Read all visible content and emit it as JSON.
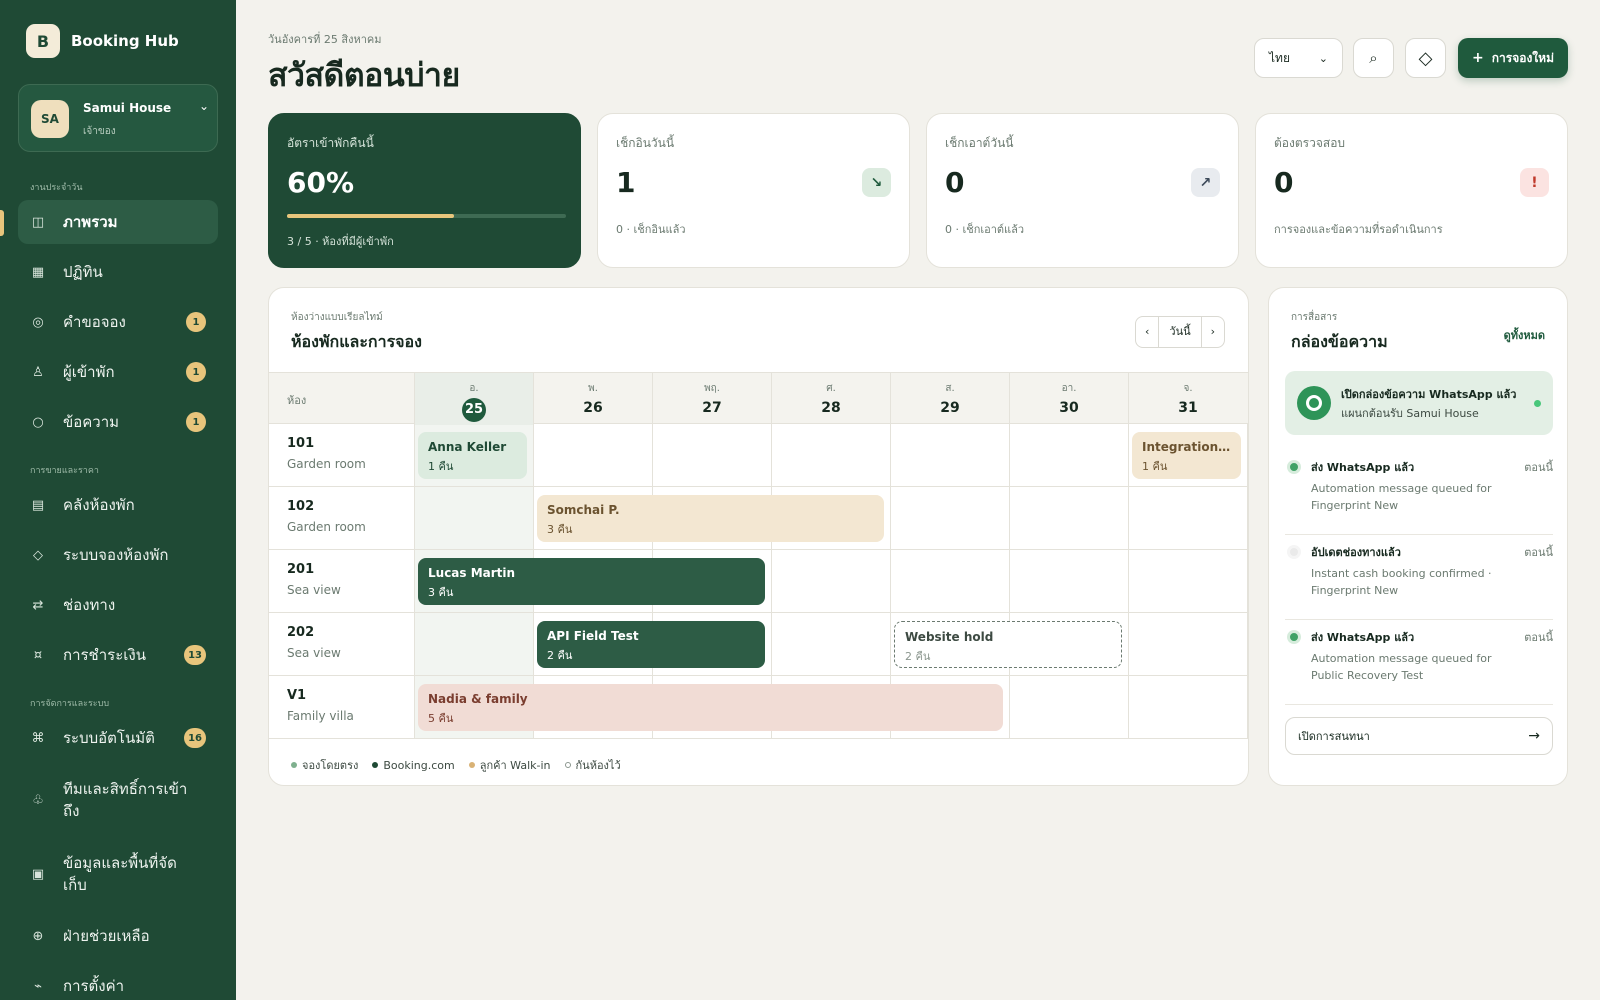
{
  "app": {
    "logo_letter": "B",
    "name": "Booking Hub"
  },
  "property": {
    "initials": "SA",
    "name": "Samui House",
    "role": "เจ้าของ"
  },
  "sidebar": {
    "sections": {
      "daily": "งานประจำวัน",
      "sales": "การขายและราคา",
      "admin": "การจัดการและระบบ"
    },
    "items": [
      {
        "label": "ภาพรวม",
        "icon": "◫",
        "badge": ""
      },
      {
        "label": "ปฏิทิน",
        "icon": "▦",
        "badge": ""
      },
      {
        "label": "คำขอจอง",
        "icon": "◎",
        "badge": "1"
      },
      {
        "label": "ผู้เข้าพัก",
        "icon": "♙",
        "badge": "1"
      },
      {
        "label": "ข้อความ",
        "icon": "○",
        "badge": "1"
      },
      {
        "label": "คลังห้องพัก",
        "icon": "▤",
        "badge": ""
      },
      {
        "label": "ระบบจองห้องพัก",
        "icon": "◇",
        "badge": ""
      },
      {
        "label": "ช่องทาง",
        "icon": "⇄",
        "badge": ""
      },
      {
        "label": "การชำระเงิน",
        "icon": "¤",
        "badge": "13"
      },
      {
        "label": "ระบบอัตโนมัติ",
        "icon": "⌘",
        "badge": "16"
      },
      {
        "label": "ทีมและสิทธิ์การเข้าถึง",
        "icon": "♧",
        "badge": ""
      },
      {
        "label": "ข้อมูลและพื้นที่จัดเก็บ",
        "icon": "▣",
        "badge": ""
      },
      {
        "label": "ฝ่ายช่วยเหลือ",
        "icon": "⊕",
        "badge": ""
      },
      {
        "label": "การตั้งค่า",
        "icon": "⌁",
        "badge": ""
      }
    ]
  },
  "header": {
    "date": "วันอังคารที่ 25 สิงหาคม",
    "greeting": "สวัสดีตอนบ่าย",
    "language": "ไทย",
    "search_icon": "⌕",
    "theme_icon": "◇",
    "new_booking": "การจองใหม่",
    "new_booking_icon": "+"
  },
  "stats": [
    {
      "label": "อัตราเข้าพักคืนนี้",
      "value": "60%",
      "sub": "3 / 5 · ห้องที่มีผู้เข้าพัก",
      "progress": 0.6
    },
    {
      "label": "เช็กอินวันนี้",
      "value": "1",
      "sub": "0 · เช็กอินแล้ว",
      "icon": "↘"
    },
    {
      "label": "เช็กเอาต์วันนี้",
      "value": "0",
      "sub": "0 · เช็กเอาต์แล้ว",
      "icon": "↗"
    },
    {
      "label": "ต้องตรวจสอบ",
      "value": "0",
      "sub": "การจองและข้อความที่รอดำเนินการ",
      "icon": "!"
    }
  ],
  "calendar": {
    "overline": "ห้องว่างแบบเรียลไทม์",
    "title": "ห้องพักและการจอง",
    "prev": "‹",
    "today": "วันนี้",
    "next": "›",
    "room_header": "ห้อง",
    "days": [
      {
        "dow": "อ.",
        "num": "25"
      },
      {
        "dow": "พ.",
        "num": "26"
      },
      {
        "dow": "พฤ.",
        "num": "27"
      },
      {
        "dow": "ศ.",
        "num": "28"
      },
      {
        "dow": "ส.",
        "num": "29"
      },
      {
        "dow": "อา.",
        "num": "30"
      },
      {
        "dow": "จ.",
        "num": "31"
      }
    ],
    "rooms": [
      {
        "num": "101",
        "type": "Garden room"
      },
      {
        "num": "102",
        "type": "Garden room"
      },
      {
        "num": "201",
        "type": "Sea view"
      },
      {
        "num": "202",
        "type": "Sea view"
      },
      {
        "num": "V1",
        "type": "Family villa"
      }
    ],
    "bookings": [
      {
        "name": "Anna Keller",
        "nights": "1 คืน",
        "room": 0,
        "start": 0,
        "len": 1,
        "kind": "direct"
      },
      {
        "name": "Integration Test",
        "nights": "1 คืน",
        "room": 0,
        "start": 6,
        "len": 1,
        "kind": "walkin"
      },
      {
        "name": "Somchai P.",
        "nights": "3 คืน",
        "room": 1,
        "start": 1,
        "len": 3,
        "kind": "walkin"
      },
      {
        "name": "Lucas Martin",
        "nights": "3 คืน",
        "room": 2,
        "start": 0,
        "len": 3,
        "kind": "booking"
      },
      {
        "name": "API Field Test",
        "nights": "2 คืน",
        "room": 3,
        "start": 1,
        "len": 2,
        "kind": "booking"
      },
      {
        "name": "Website hold",
        "nights": "2 คืน",
        "room": 3,
        "start": 4,
        "len": 2,
        "kind": "hold"
      },
      {
        "name": "Nadia & family",
        "nights": "5 คืน",
        "room": 4,
        "start": 0,
        "len": 5,
        "kind": "family"
      }
    ],
    "legend": [
      {
        "label": "จองโดยตรง",
        "color": "#7fb08e"
      },
      {
        "label": "Booking.com",
        "color": "#1f4a35"
      },
      {
        "label": "ลูกค้า Walk-in",
        "color": "#d9b275"
      },
      {
        "label": "กันห้องไว้",
        "color": "#ffffff"
      }
    ]
  },
  "inbox": {
    "overline": "การสื่อสาร",
    "title": "กล่องข้อความ",
    "view_all": "ดูทั้งหมด",
    "banner_title": "เปิดกล่องข้อความ WhatsApp แล้ว",
    "banner_sub": "แผนกต้อนรับ Samui House",
    "messages": [
      {
        "title": "ส่ง WhatsApp แล้ว",
        "time": "ตอนนี้",
        "body": "Automation message queued for Fingerprint New"
      },
      {
        "title": "อัปเดตช่องทางแล้ว",
        "time": "ตอนนี้",
        "body": "Instant cash booking confirmed · Fingerprint New"
      },
      {
        "title": "ส่ง WhatsApp แล้ว",
        "time": "ตอนนี้",
        "body": "Automation message queued for Public Recovery Test"
      }
    ],
    "open_chat": "เปิดการสนทนา",
    "open_chat_icon": "→"
  }
}
